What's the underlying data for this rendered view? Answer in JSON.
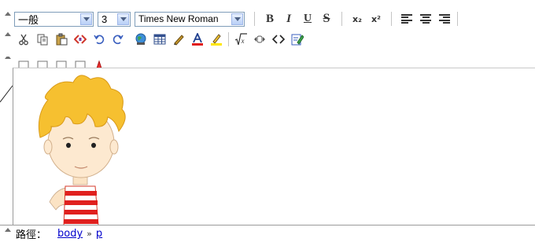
{
  "toolbar": {
    "format_select": "一般",
    "size_select": "3",
    "font_select": "Times New Roman",
    "bold": "B",
    "italic": "I",
    "underline": "U",
    "strike": "S",
    "subscript": "x₂",
    "superscript": "x²"
  },
  "status": {
    "path_label": "路徑：",
    "crumbs": [
      "body",
      "p"
    ],
    "separator": "»"
  },
  "colors": {
    "select_border": "#7f9db9",
    "link": "#0000cc",
    "hair": "#F6C030",
    "shirt_stripe": "#E0201E"
  }
}
